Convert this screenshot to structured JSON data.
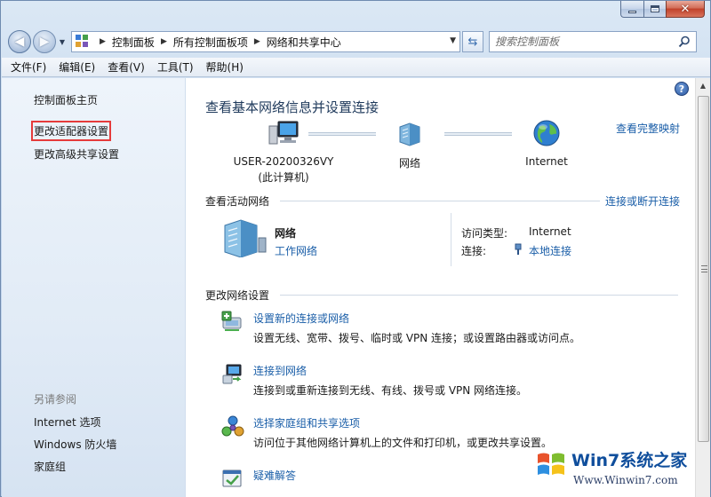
{
  "colors": {
    "link": "#1a5ea8",
    "highlight_box": "#e53b3b",
    "title": "#1e395b"
  },
  "address_bar": {
    "icon": "control-panel-icon",
    "segments": [
      "控制面板",
      "所有控制面板项",
      "网络和共享中心"
    ]
  },
  "search": {
    "placeholder": "搜索控制面板"
  },
  "menu": [
    "文件(F)",
    "编辑(E)",
    "查看(V)",
    "工具(T)",
    "帮助(H)"
  ],
  "sidebar": {
    "links": [
      "控制面板主页",
      "更改适配器设置",
      "更改高级共享设置"
    ],
    "highlighted": "更改适配器设置",
    "see_also_title": "另请参阅",
    "see_also": [
      "Internet 选项",
      "Windows 防火墙",
      "家庭组"
    ]
  },
  "main": {
    "title": "查看基本网络信息并设置连接",
    "view_full_map": "查看完整映射",
    "map": {
      "computer_line1": "USER-20200326VY",
      "computer_line2": "(此计算机)",
      "network": "网络",
      "internet": "Internet"
    },
    "active_networks": {
      "label": "查看活动网络",
      "connect_link": "连接或断开连接",
      "name": "网络",
      "type": "工作网络",
      "access_type_label": "访问类型:",
      "access_type_value": "Internet",
      "connection_label": "连接:",
      "connection_value": "本地连接"
    },
    "change_settings": {
      "label": "更改网络设置",
      "tasks": [
        {
          "title": "设置新的连接或网络",
          "desc": "设置无线、宽带、拨号、临时或 VPN 连接；或设置路由器或访问点。"
        },
        {
          "title": "连接到网络",
          "desc": "连接到或重新连接到无线、有线、拨号或 VPN 网络连接。"
        },
        {
          "title": "选择家庭组和共享选项",
          "desc": "访问位于其他网络计算机上的文件和打印机，或更改共享设置。"
        },
        {
          "title": "疑难解答",
          "desc": ""
        }
      ]
    }
  },
  "watermark": {
    "title": "Win7系统之家",
    "url": "Www.Winwin7.com"
  }
}
